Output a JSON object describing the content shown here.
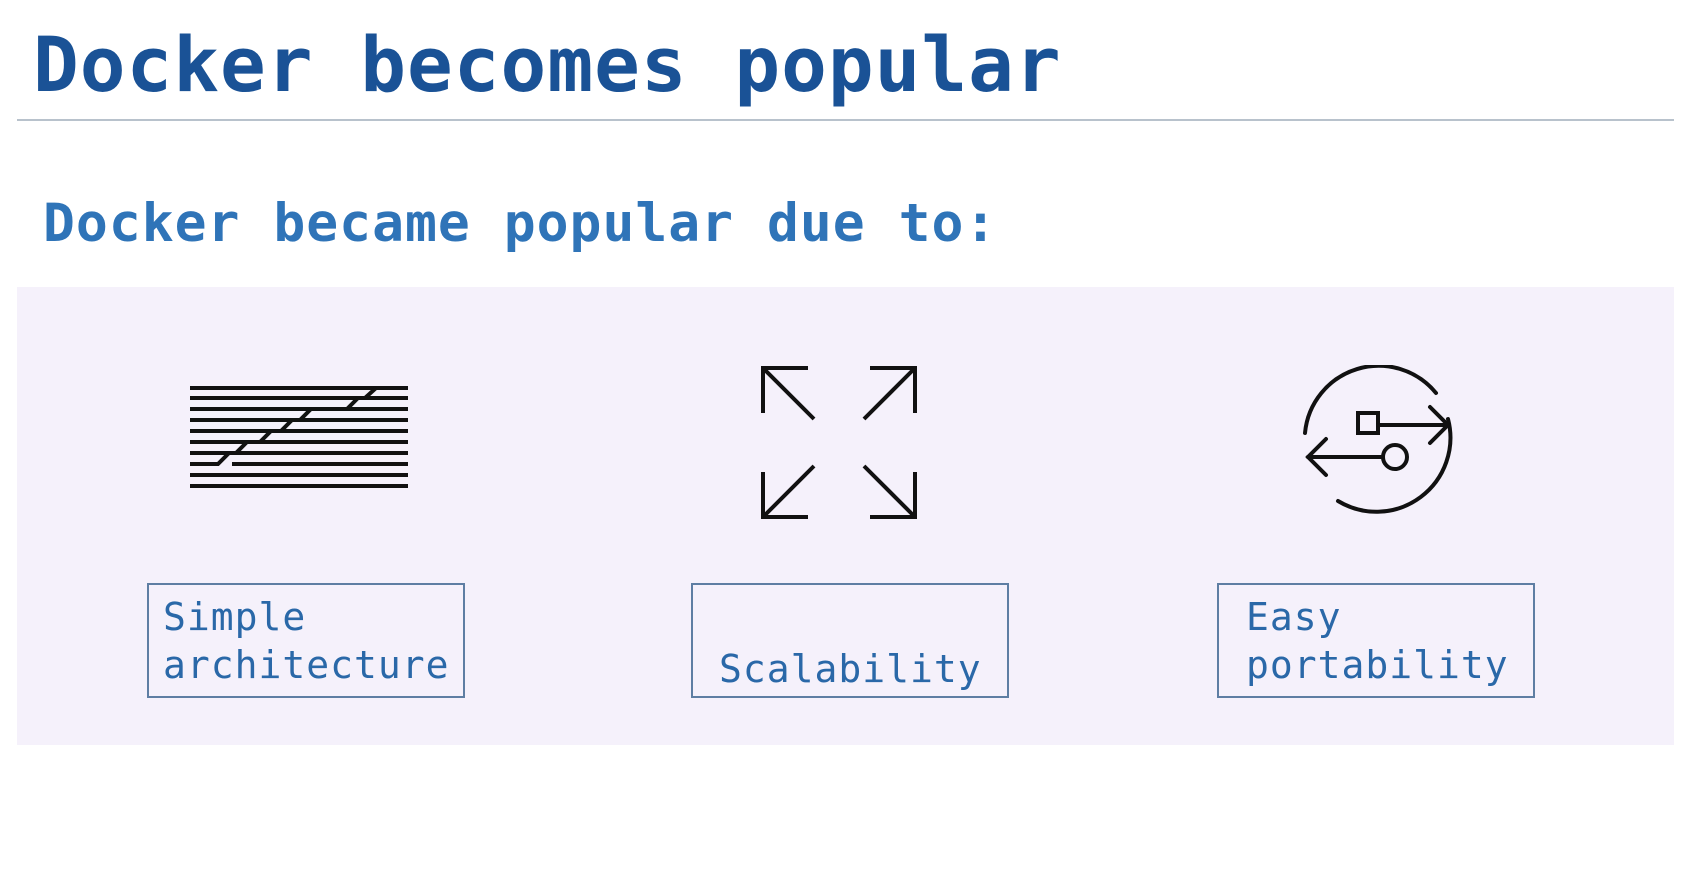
{
  "slide": {
    "title": "Docker becomes popular",
    "subtitle": "Docker became popular due to:"
  },
  "features": [
    {
      "label": "Simple\narchitecture",
      "icon": "architecture-lines-icon"
    },
    {
      "label": "Scalability",
      "icon": "expand-arrows-icon"
    },
    {
      "label": "Easy\nportability",
      "icon": "portability-cycle-icon"
    }
  ],
  "colors": {
    "title": "#1a5296",
    "subtitle": "#2f74b8",
    "label": "#2a68a8",
    "panel": "#f5f1fb",
    "box_border": "#5e7ea3"
  }
}
